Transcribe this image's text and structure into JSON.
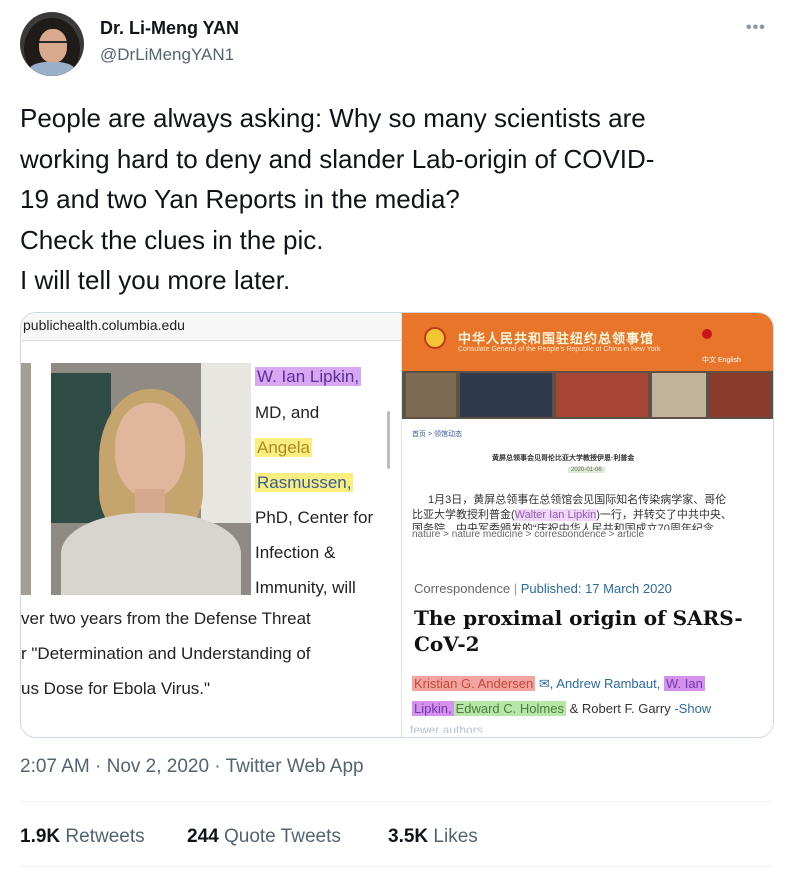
{
  "author": {
    "name": "Dr. Li-Meng YAN",
    "handle": "@DrLiMengYAN1",
    "more_icon": "more-horizontal-icon",
    "more_label": "•••"
  },
  "tweet": {
    "lines": [
      "People are always asking: Why so many scientists are",
      "working hard to deny and slander Lab-origin of COVID-",
      "19 and two Yan Reports in the media?",
      "Check the clues in the pic.",
      "I will tell you more later."
    ]
  },
  "image": {
    "left": {
      "url": "publichealth.columbia.edu",
      "bio": {
        "name1": "W. Ian Lipkin,",
        "l2": "MD, and",
        "name2a": "Angela",
        "name2b": "Rasmussen,",
        "l5": "PhD, Center for",
        "l6": "Infection &",
        "l7": "Immunity, will"
      },
      "bottom": [
        "ver two years from the Defense Threat",
        "r \"Determination and Understanding of",
        "us Dose for Ebola Virus.\""
      ]
    },
    "right": {
      "cn_title": "中华人民共和国驻纽约总领事馆",
      "cn_subtitle": "Consulate General of the People's Republic of China in New York",
      "cn_lang": "中文  English",
      "crumb": "首页 > 领馆动态",
      "cn_headline": "黄屏总领事会见哥伦比亚大学教授伊恩·利普金",
      "cn_date": "2020-01-06",
      "cn_p1": "1月3日，黄屏总领事在总领馆会见国际知名传染病学家、哥伦",
      "cn_p2a": "比亚大学教授利普金(",
      "cn_p2_hl": "Walter Ian Lipkin",
      "cn_p2b": ")一行，并转交了中共中央、",
      "cn_p3": "国务院、中央军委颁发的“庆祝中华人民共和国成立70周年纪念",
      "cn_cut": "nature > nature medicine > correspondence > article",
      "correspondence": "Correspondence",
      "published": "Published: 17 March 2020",
      "title_line1": "The proximal origin of SARS-",
      "title_line2": "CoV-2",
      "authors": {
        "a1": "Kristian G. Andersen",
        "mail_icon": "mail-icon",
        "a2": ", Andrew Rambaut,",
        "a3a": "W. Ian",
        "a3b": "Lipkin,",
        "a4": "Edward C. Holmes",
        "a5": "& Robert F. Garry",
        "show": "-Show",
        "faded": "fewer authors"
      }
    }
  },
  "meta": {
    "time": "2:07 AM",
    "date": "Nov 2, 2020",
    "source": "Twitter Web App",
    "sep": "·"
  },
  "stats": {
    "retweets_count": "1.9K",
    "retweets_label": "Retweets",
    "quotes_count": "244",
    "quotes_label": "Quote Tweets",
    "likes_count": "3.5K",
    "likes_label": "Likes"
  }
}
